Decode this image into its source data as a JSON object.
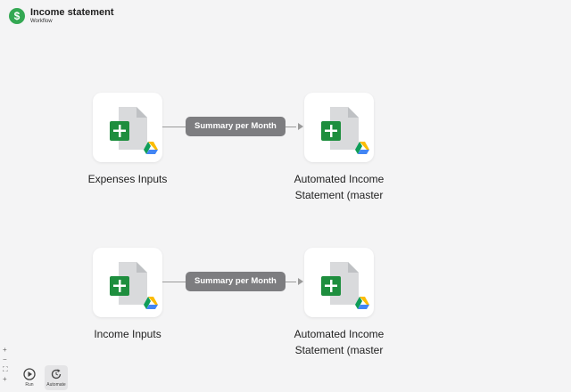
{
  "header": {
    "logo_glyph": "$",
    "title": "Income statement",
    "subtitle": "Workflow",
    "accent": "#34a853"
  },
  "flows": [
    {
      "source": {
        "label": "Expenses Inputs",
        "icon": "google-sheets-icon",
        "badge": "google-drive-icon"
      },
      "step": {
        "label": "Summary per Month"
      },
      "target": {
        "label_line1": "Automated Income",
        "label_line2": "Statement (master",
        "icon": "google-sheets-icon",
        "badge": "google-drive-icon"
      }
    },
    {
      "source": {
        "label": "Income Inputs",
        "icon": "google-sheets-icon",
        "badge": "google-drive-icon"
      },
      "step": {
        "label": "Summary per Month"
      },
      "target": {
        "label_line1": "Automated Income",
        "label_line2": "Statement (master",
        "icon": "google-sheets-icon",
        "badge": "google-drive-icon"
      }
    }
  ],
  "zoom_controls": {
    "zoom_in": "+",
    "zoom_out": "−",
    "fit": "⛶",
    "reset": "+"
  },
  "toolbar": {
    "run_label": "Run",
    "automate_label": "Automate"
  },
  "colors": {
    "canvas": "#f4f4f5",
    "pill": "#7d7d80",
    "sheets_green": "#1e8e3e",
    "doc_gray": "#d9dadc"
  }
}
